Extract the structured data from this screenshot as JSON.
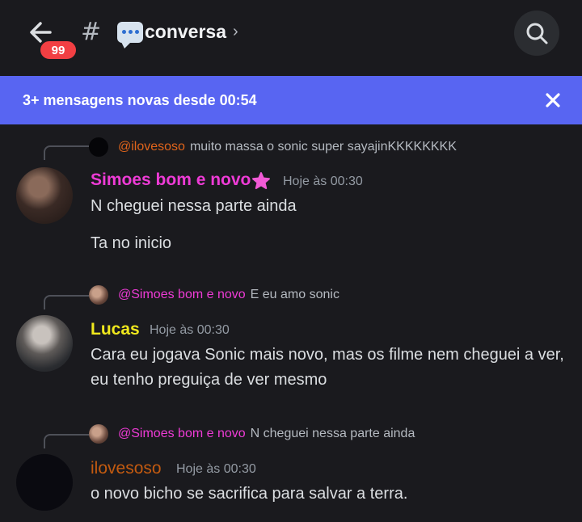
{
  "header": {
    "unread_badge": "99",
    "hash_symbol": "#",
    "channel_name": "conversa",
    "chevron": "›"
  },
  "banner": {
    "text": "3+ mensagens novas desde 00:54"
  },
  "messages": [
    {
      "reply_to_user": "@ilovesoso",
      "reply_to_color": "#e0641b",
      "reply_to_text": "muito massa o sonic super sayajinKKKKKKKK",
      "author": "Simoes bom e novo",
      "author_color": "#ee3bd6",
      "badge_icon": "pink-flower-icon",
      "timestamp": "Hoje às 00:30",
      "lines": [
        "N cheguei nessa parte ainda",
        "Ta no inicio"
      ]
    },
    {
      "reply_to_user": "@Simoes bom e novo",
      "reply_to_color": "#ee3bd6",
      "reply_to_text": "E eu amo sonic",
      "author": "Lucas",
      "author_color": "#f0e81d",
      "timestamp": "Hoje às 00:30",
      "lines": [
        "Cara eu jogava Sonic mais novo, mas os filme nem cheguei a ver, eu tenho preguiça de ver mesmo"
      ]
    },
    {
      "reply_to_user": "@Simoes bom e novo",
      "reply_to_color": "#ee3bd6",
      "reply_to_text": "N cheguei nessa parte ainda",
      "author": "ilovesoso",
      "author_color": "#c25a10",
      "timestamp": "Hoje às 00:30",
      "lines": [
        "o novo bicho se sacrifica para salvar a terra."
      ]
    }
  ],
  "colors": {
    "background": "#1a1a1e",
    "banner": "#5865f2",
    "badge": "#f23f43"
  }
}
